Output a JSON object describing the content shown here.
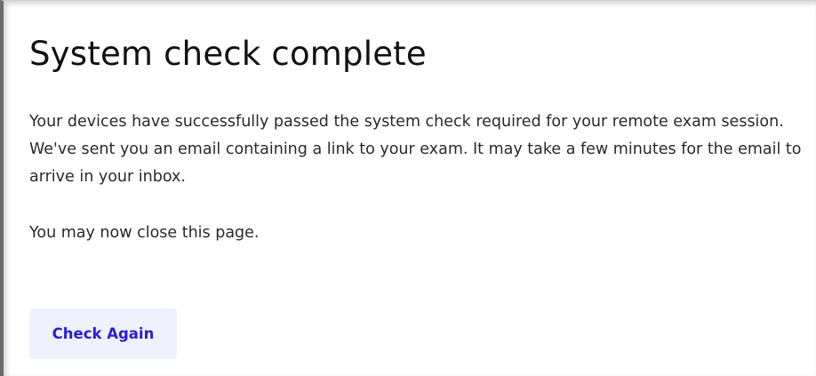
{
  "page": {
    "title": "System check complete",
    "message": "Your devices have successfully passed the system check required for your remote exam session. We've sent you an email containing a link to your exam. It may take a few minutes for the email to arrive in your inbox.",
    "close_note": "You may now close this page.",
    "check_again_label": "Check Again"
  },
  "colors": {
    "button_background": "#f0f1fe",
    "button_text": "#2a1be0",
    "title_text": "#111111",
    "body_text": "#2a2a2a"
  }
}
